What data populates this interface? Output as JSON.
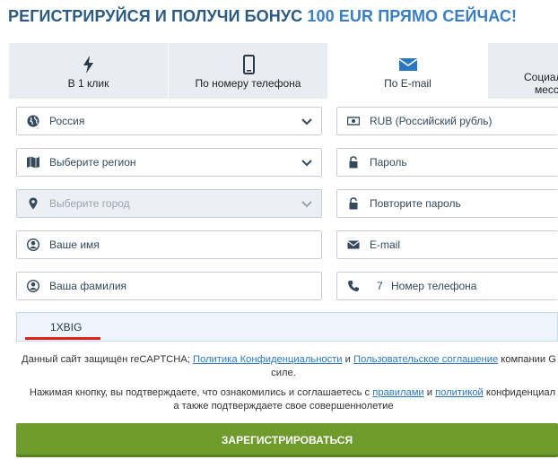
{
  "heading": {
    "part1": "РЕГИСТРИРУЙСЯ И ПОЛУЧИ БОНУС",
    "part2": "100 EUR ПРЯМО СЕЙЧАС!"
  },
  "tabs": [
    {
      "label": "В 1 клик",
      "icon": "lightning-icon",
      "active": false
    },
    {
      "label": "По номеру телефона",
      "icon": "phone-icon",
      "active": false
    },
    {
      "label": "По E-mail",
      "icon": "envelope-icon",
      "active": true
    },
    {
      "label_line1": "Социал",
      "label_line2": "месс",
      "icon": "none",
      "active": false
    }
  ],
  "left_fields": {
    "country": {
      "value": "Россия",
      "icon": "globe-icon"
    },
    "region": {
      "placeholder": "Выберите регион",
      "icon": "map-icon"
    },
    "city": {
      "placeholder": "Выберите город",
      "icon": "map-pin-icon",
      "disabled": true
    },
    "name": {
      "placeholder": "Ваше имя",
      "icon": "user-icon"
    },
    "surname": {
      "placeholder": "Ваша фамилия",
      "icon": "user-icon"
    }
  },
  "right_fields": {
    "currency": {
      "value": "RUB (Российский рубль)",
      "icon": "money-icon"
    },
    "password": {
      "placeholder": "Пароль",
      "icon": "lock-icon"
    },
    "password_repeat": {
      "placeholder": "Повторите пароль",
      "icon": "lock-icon"
    },
    "email": {
      "placeholder": "E-mail",
      "icon": "envelope-icon"
    },
    "phone": {
      "code": "7",
      "placeholder": "Номер телефона",
      "icon": "phone-icon"
    }
  },
  "promo": {
    "value": "1XBIG"
  },
  "recaptcha": {
    "text1": "Данный сайт защищён reCAPTCHA;",
    "link1": "Политика Конфиденциальности",
    "and": "и",
    "link2": "Пользовательское соглашение",
    "text2": "компании G",
    "text3": "силе."
  },
  "agree": {
    "text1": "Нажимая кнопку, вы подтверждаете, что ознакомились и соглашаетесь с",
    "link1": "правилами",
    "and": "и",
    "link2": "политикой",
    "text2": "конфиденциал",
    "line2": "а также подтверждаете свое совершеннолетие"
  },
  "submit": {
    "label": "ЗАРЕГИСТРИРОВАТЬСЯ"
  },
  "colors": {
    "accent": "#3a7fc3",
    "button": "#6f9b2c",
    "link": "#2a78c2"
  }
}
